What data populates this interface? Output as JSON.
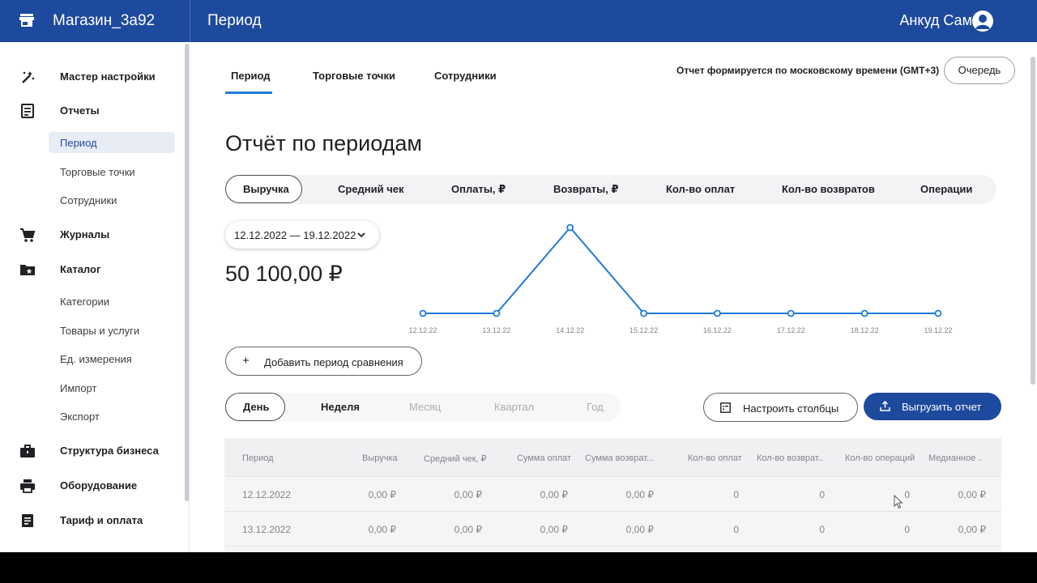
{
  "header": {
    "store_name": "Магазин_3а92",
    "page_title": "Период",
    "user_name": "Анкуд Сами",
    "brand_color": "#1e4a9e"
  },
  "sidebar": {
    "items": [
      {
        "label": "Мастер настройки",
        "icon": "magic-wand-icon"
      },
      {
        "label": "Отчеты",
        "icon": "report-icon"
      },
      {
        "label": "Журналы",
        "icon": "cart-icon"
      },
      {
        "label": "Каталог",
        "icon": "folder-star-icon"
      },
      {
        "label": "Структура бизнеса",
        "icon": "briefcase-icon"
      },
      {
        "label": "Оборудование",
        "icon": "printer-icon"
      },
      {
        "label": "Тариф и оплата",
        "icon": "receipt-icon"
      }
    ],
    "reports_sub": [
      "Период",
      "Торговые точки",
      "Сотрудники"
    ],
    "catalog_sub": [
      "Категории",
      "Товары и услуги",
      "Ед. измерения",
      "Импорт",
      "Экспорт"
    ],
    "active_sub": "Период"
  },
  "tabs": [
    "Период",
    "Торговые точки",
    "Сотрудники"
  ],
  "timezone_note": "Отчет формируется по московскому времени (GMT+3)",
  "queue_label": "Очередь",
  "report_title": "Отчёт по периодам",
  "metrics": [
    "Выручка",
    "Средний чек",
    "Оплаты, ₽",
    "Возвраты, ₽",
    "Кол-во оплат",
    "Кол-во возвратов",
    "Операции"
  ],
  "active_metric": "Выручка",
  "date_range": "12.12.2022 — 19.12.2022",
  "total": "50 100,00 ₽",
  "chart_data": {
    "type": "line",
    "categories": [
      "12.12.22",
      "13.12.22",
      "14.12.22",
      "15.12.22",
      "16.12.22",
      "17.12.22",
      "18.12.22",
      "19.12.22"
    ],
    "values": [
      0,
      0,
      50100,
      0,
      0,
      0,
      0,
      0
    ],
    "ylim": [
      0,
      50100
    ],
    "color": "#1e7bd8",
    "grid": false
  },
  "add_compare_label": "Добавить период сравнения",
  "periods": [
    "День",
    "Неделя",
    "Месяц",
    "Квартал",
    "Год"
  ],
  "active_period": "День",
  "columns_button": "Настроить столбцы",
  "export_button": "Выгрузить отчет",
  "table": {
    "headers": [
      "Период",
      "Выручка",
      "Средний чек, ₽",
      "Сумма оплат",
      "Сумма возврат...",
      "Кол-во оплат",
      "Кол-во возврат...",
      "Кол-во операций",
      "Медианное ..."
    ],
    "rows": [
      [
        "12.12.2022",
        "0,00 ₽",
        "0,00 ₽",
        "0,00 ₽",
        "0,00 ₽",
        "0",
        "0",
        "0",
        "0,00 ₽"
      ],
      [
        "13.12.2022",
        "0,00 ₽",
        "0,00 ₽",
        "0,00 ₽",
        "0,00 ₽",
        "0",
        "0",
        "0",
        "0,00 ₽"
      ]
    ]
  }
}
